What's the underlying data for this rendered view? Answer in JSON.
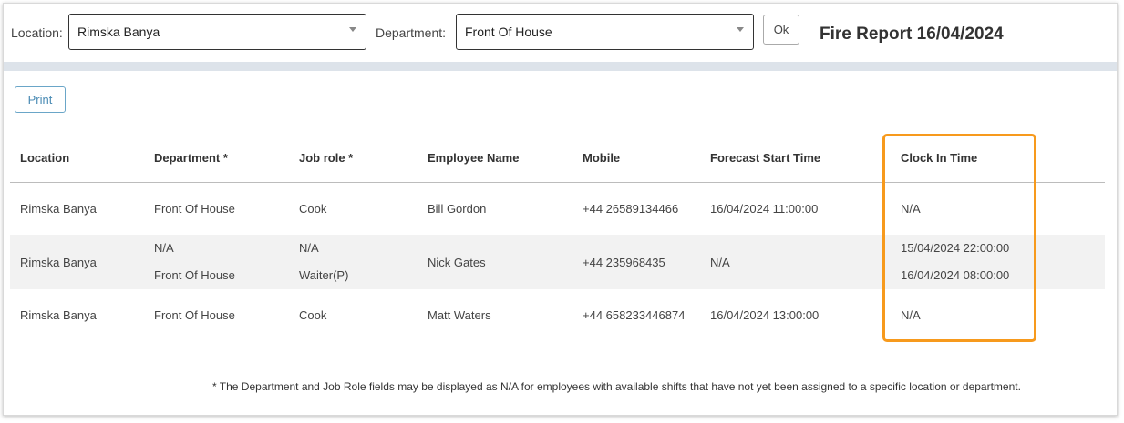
{
  "filters": {
    "location_label": "Location:",
    "location_value": "Rimska Banya",
    "department_label": "Department:",
    "department_value": "Front Of House",
    "ok_label": "Ok"
  },
  "report_title": "Fire Report 16/04/2024",
  "print_label": "Print",
  "table": {
    "headers": [
      "Location",
      "Department *",
      "Job role *",
      "Employee Name",
      "Mobile",
      "Forecast Start Time",
      "Clock In Time"
    ],
    "rows": [
      {
        "location": "Rimska Banya",
        "department": [
          "Front Of House"
        ],
        "job_role": [
          "Cook"
        ],
        "employee": "Bill Gordon",
        "mobile": "+44 26589134466",
        "forecast": "16/04/2024 11:00:00",
        "clock_in": [
          "N/A"
        ]
      },
      {
        "location": "Rimska Banya",
        "department": [
          "N/A",
          "Front Of House"
        ],
        "job_role": [
          "N/A",
          "Waiter(P)"
        ],
        "employee": "Nick Gates",
        "mobile": "+44 235968435",
        "forecast": "N/A",
        "clock_in": [
          "15/04/2024 22:00:00",
          "16/04/2024 08:00:00"
        ]
      },
      {
        "location": "Rimska Banya",
        "department": [
          "Front Of House"
        ],
        "job_role": [
          "Cook"
        ],
        "employee": "Matt Waters",
        "mobile": "+44 658233446874",
        "forecast": "16/04/2024 13:00:00",
        "clock_in": [
          "N/A"
        ]
      }
    ]
  },
  "footnote": "* The Department and Job Role fields may be displayed as N/A for employees with available shifts that have not yet been assigned to a specific location or department.",
  "colors": {
    "highlight": "#f79a1d",
    "print_button": "#4a8bb4",
    "band": "#dde3ea"
  }
}
